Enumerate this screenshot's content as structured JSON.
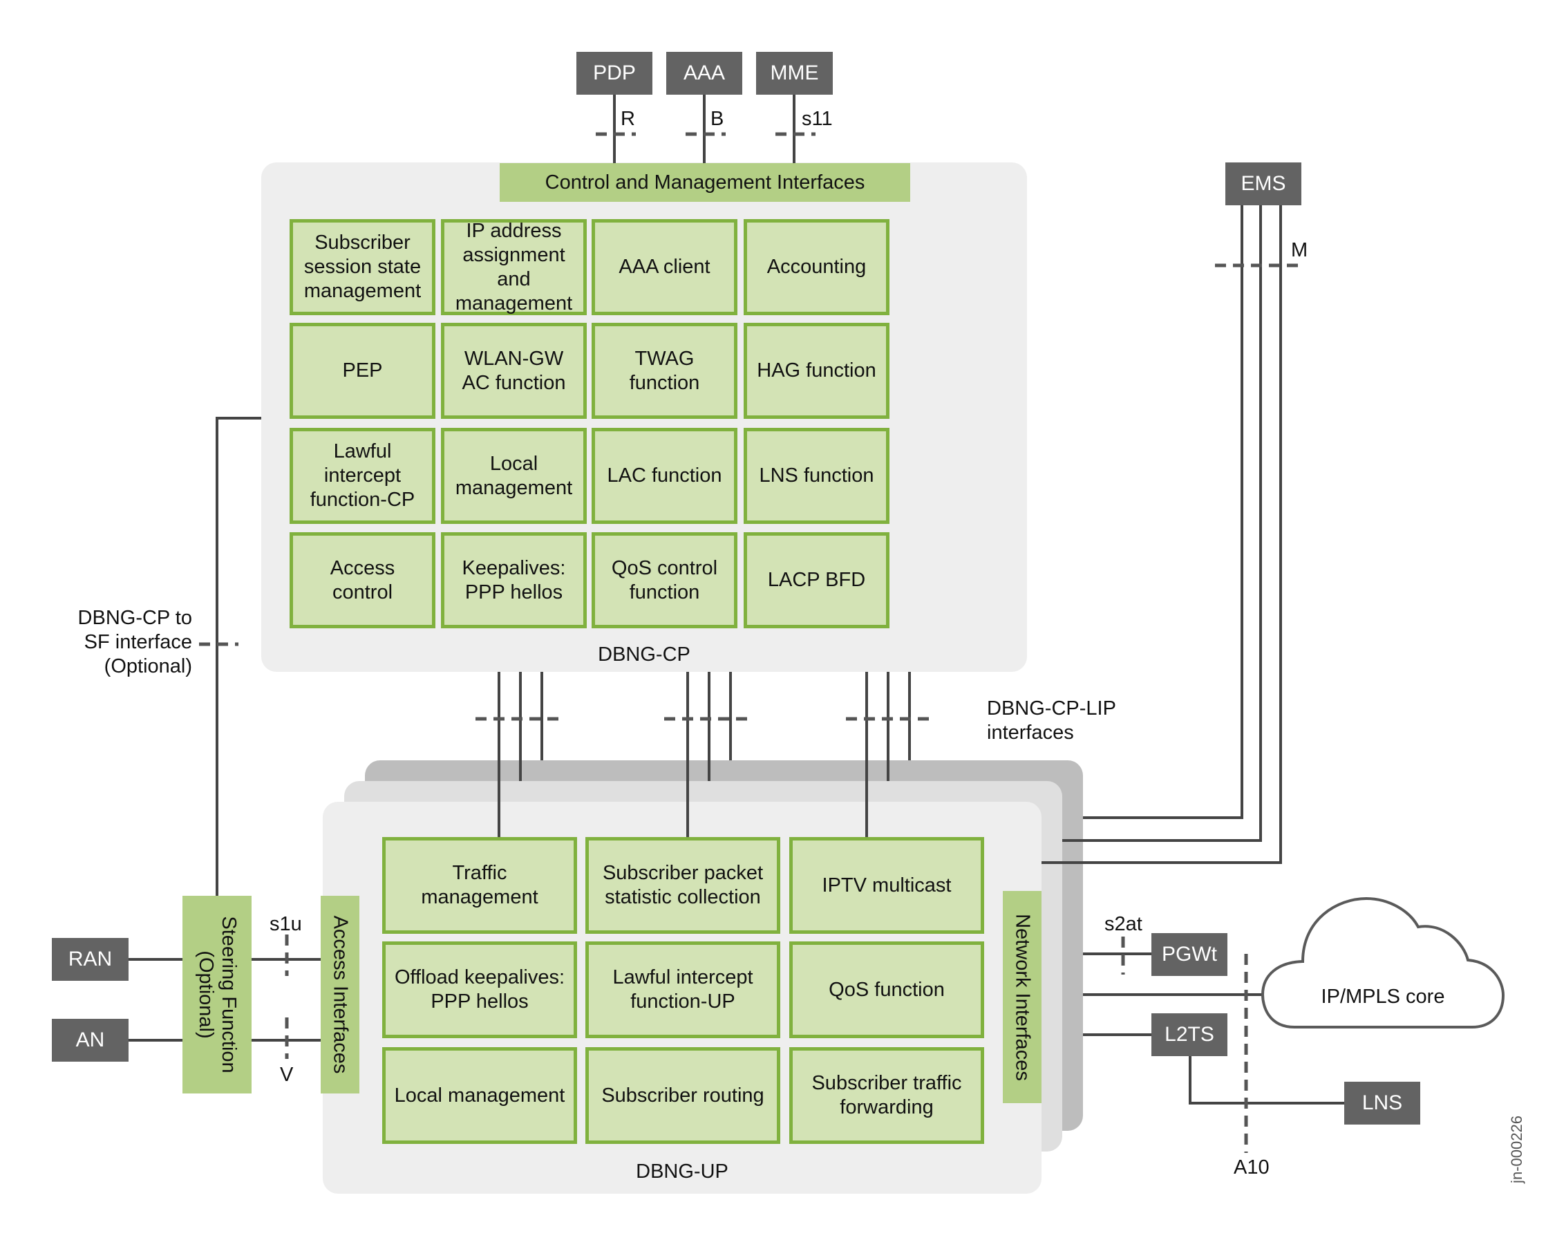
{
  "external_nodes": {
    "pdp": "PDP",
    "aaa": "AAA",
    "mme": "MME",
    "ems": "EMS",
    "ran": "RAN",
    "an": "AN",
    "pgwt": "PGWt",
    "l2ts": "L2TS",
    "lns": "LNS"
  },
  "interface_labels": {
    "r": "R",
    "b": "B",
    "s11": "s11",
    "m": "M",
    "s1u": "s1u",
    "v": "V",
    "s2at": "s2at",
    "a10": "A10",
    "cp_lip": [
      "DBNG-CP-LIP",
      "interfaces"
    ],
    "cp_to_sf": [
      "DBNG-CP to",
      "SF interface",
      "(Optional)"
    ]
  },
  "cp": {
    "title": "DBNG-CP",
    "header_band": "Control and Management Interfaces",
    "functions": [
      "Subscriber session state management",
      "IP address assignment and management",
      "AAA client",
      "Accounting",
      "PEP",
      "WLAN-GW AC function",
      "TWAG function",
      "HAG function",
      "Lawful intercept function-CP",
      "Local management",
      "LAC function",
      "LNS function",
      "Access control",
      "Keepalives: PPP hellos",
      "QoS control function",
      "LACP BFD"
    ]
  },
  "up": {
    "title": "DBNG-UP",
    "access_band": "Access Interfaces",
    "network_band": "Network Interfaces",
    "functions": [
      "Traffic management",
      "Subscriber packet statistic collection",
      "IPTV multicast",
      "Offload keepalives: PPP hellos",
      "Lawful intercept function-UP",
      "QoS function",
      "Local management",
      "Subscriber routing",
      "Subscriber traffic forwarding"
    ]
  },
  "steering": {
    "line1": "Steering Function",
    "line2": "(Optional)"
  },
  "cloud": {
    "label": "IP/MPLS core"
  },
  "figure_id": "jn-000226",
  "colors": {
    "node_gray": "#636363",
    "function_fill": "#d3e3b5",
    "function_border": "#80b13e",
    "band_green": "#b3cf85",
    "panel_gray": "#eeeeee",
    "wire": "#444444"
  }
}
